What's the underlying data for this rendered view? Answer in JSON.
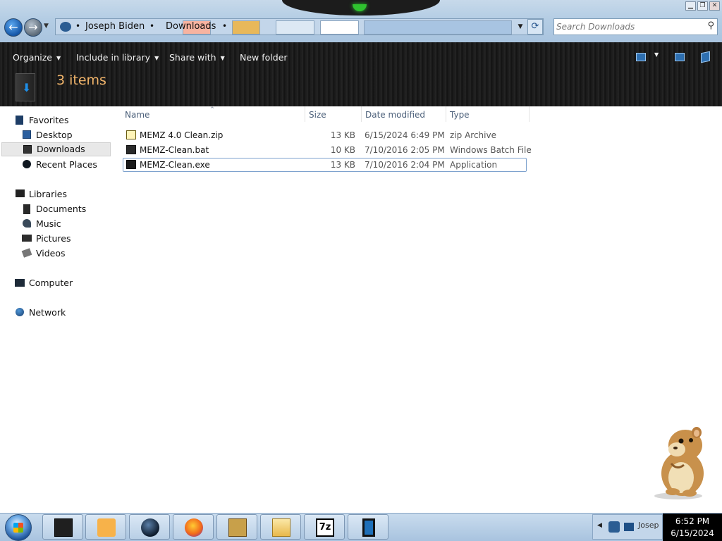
{
  "window": {
    "breadcrumbs": [
      "Joseph Biden",
      "Downloads"
    ],
    "separator": "•",
    "search_placeholder": "Search Downloads",
    "controls": {
      "minimize": "▁",
      "maximize": "❐",
      "close": "✕"
    }
  },
  "toolbar": {
    "organize": "Organize",
    "include_in_library": "Include in library",
    "share_with": "Share with",
    "new_folder": "New folder",
    "dropdown_arrow": "▼"
  },
  "header": {
    "items_count": "3 items"
  },
  "sidebar": {
    "favorites": {
      "title": "Favorites",
      "items": [
        {
          "label": "Desktop",
          "icon": "desktop-icon"
        },
        {
          "label": "Downloads",
          "icon": "downloads-icon",
          "selected": true
        },
        {
          "label": "Recent Places",
          "icon": "recent-places-icon"
        }
      ]
    },
    "libraries": {
      "title": "Libraries",
      "items": [
        {
          "label": "Documents",
          "icon": "documents-icon"
        },
        {
          "label": "Music",
          "icon": "music-icon"
        },
        {
          "label": "Pictures",
          "icon": "pictures-icon"
        },
        {
          "label": "Videos",
          "icon": "videos-icon"
        }
      ]
    },
    "computer": "Computer",
    "network": "Network"
  },
  "filelist": {
    "columns": [
      "Name",
      "Size",
      "Date modified",
      "Type"
    ],
    "sort_indicator": "^",
    "rows": [
      {
        "name": "MEMZ 4.0 Clean.zip",
        "size": "13 KB",
        "date": "6/15/2024 6:49 PM",
        "type": "zip Archive",
        "icon": "zip-file-icon"
      },
      {
        "name": "MEMZ-Clean.bat",
        "size": "10 KB",
        "date": "7/10/2016 2:05 PM",
        "type": "Windows Batch File",
        "icon": "batch-file-icon"
      },
      {
        "name": "MEMZ-Clean.exe",
        "size": "13 KB",
        "date": "7/10/2016 2:04 PM",
        "type": "Application",
        "icon": "exe-file-icon",
        "focused": true
      }
    ]
  },
  "taskbar": {
    "buttons": [
      "explorer-window",
      "media-player",
      "globe-browser",
      "firefox",
      "bonzi-box",
      "windows-explorer",
      "7-zip",
      "tablet-app"
    ],
    "tray_label": "Josep",
    "clock_time": "6:52 PM",
    "clock_date": "6/15/2024"
  },
  "colors": {
    "accent_orange": "#f2b56b",
    "selection_border": "#7da2ce",
    "command_bar": "#1f1f1f",
    "clock_bg": "#000000"
  }
}
